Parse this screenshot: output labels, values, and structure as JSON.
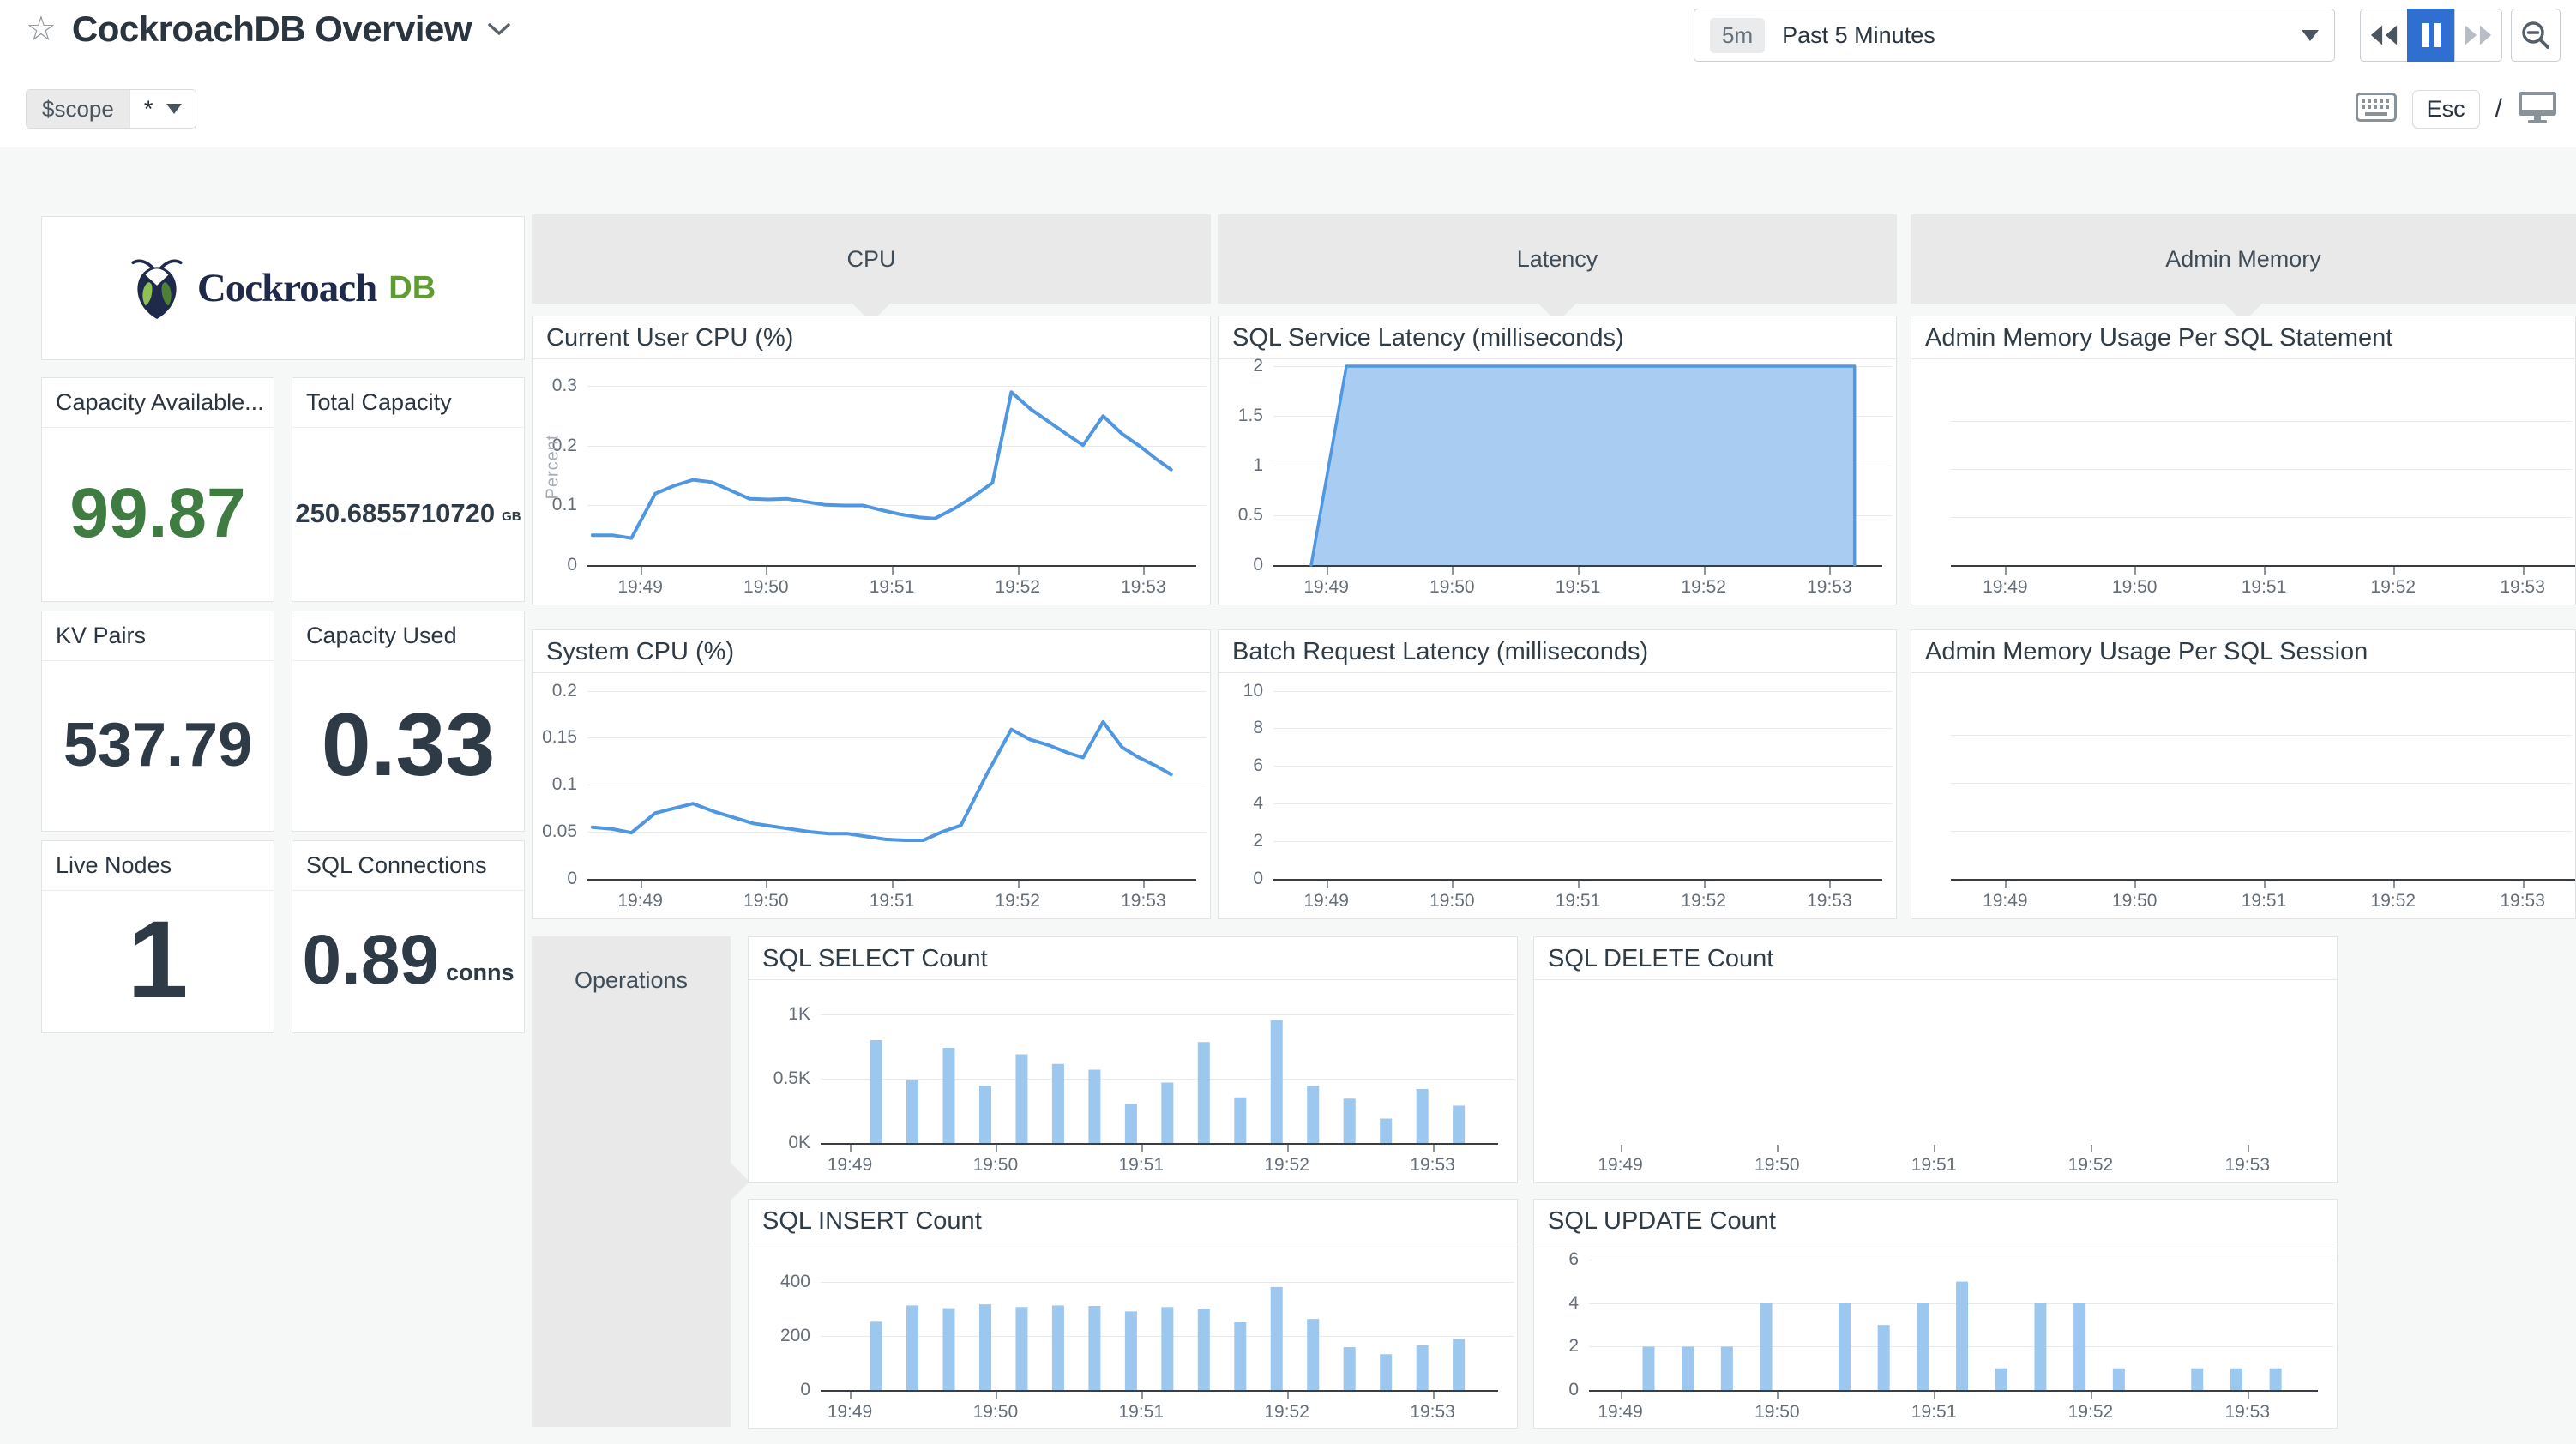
{
  "header": {
    "title": "CockroachDB Overview",
    "time_range": {
      "badge": "5m",
      "label": "Past 5 Minutes"
    },
    "controls": {
      "esc_label": "Esc",
      "slash": "/"
    },
    "scope": {
      "label": "$scope",
      "value": "*"
    }
  },
  "branding": {
    "wordmark": "Cockroach",
    "wordmark_suffix": "DB"
  },
  "sections": {
    "cpu": "CPU",
    "latency": "Latency",
    "admin_memory": "Admin Memory",
    "operations": "Operations"
  },
  "colors": {
    "accent_blue": "#4f97e0",
    "area_fill": "#a9cdf2",
    "bar_blue": "#9cc7ef",
    "stat_green": "#3e7c41",
    "stat_dark": "#2e3a46",
    "active_button_blue": "#2e6fd0",
    "logo_navy": "#1f2a4a",
    "logo_green": "#5f9c31"
  },
  "stats": [
    {
      "id": "capacity-available",
      "title": "Capacity Available...",
      "value": "99.87",
      "unit": ""
    },
    {
      "id": "total-capacity",
      "title": "Total Capacity",
      "value": "250.6855710720",
      "unit": "GB"
    },
    {
      "id": "kv-pairs",
      "title": "KV Pairs",
      "value": "537.79",
      "unit": ""
    },
    {
      "id": "capacity-used",
      "title": "Capacity Used",
      "value": "0.33",
      "unit": ""
    },
    {
      "id": "live-nodes",
      "title": "Live Nodes",
      "value": "1",
      "unit": ""
    },
    {
      "id": "sql-connections",
      "title": "SQL Connections",
      "value": "0.89",
      "unit": "conns"
    }
  ],
  "time_axis": {
    "range": [
      48.58,
      53.42
    ],
    "ticks": [
      {
        "t": 49,
        "l": "19:49"
      },
      {
        "t": 50,
        "l": "19:50"
      },
      {
        "t": 51,
        "l": "19:51"
      },
      {
        "t": 52,
        "l": "19:52"
      },
      {
        "t": 53,
        "l": "19:53"
      }
    ]
  },
  "chart_data": [
    {
      "id": "user-cpu",
      "type": "line",
      "title": "Current User CPU (%)",
      "ylabel": "Percent",
      "ymax": 0.325,
      "yticks": [
        {
          "v": 0,
          "l": "0"
        },
        {
          "v": 0.1,
          "l": "0.1"
        },
        {
          "v": 0.2,
          "l": "0.2"
        },
        {
          "v": 0.3,
          "l": "0.3"
        }
      ],
      "points": [
        [
          48.62,
          0.05
        ],
        [
          48.78,
          0.05
        ],
        [
          48.93,
          0.045
        ],
        [
          49.12,
          0.12
        ],
        [
          49.27,
          0.133
        ],
        [
          49.42,
          0.143
        ],
        [
          49.57,
          0.139
        ],
        [
          49.72,
          0.125
        ],
        [
          49.87,
          0.111
        ],
        [
          50.02,
          0.11
        ],
        [
          50.17,
          0.111
        ],
        [
          50.32,
          0.106
        ],
        [
          50.47,
          0.101
        ],
        [
          50.62,
          0.1
        ],
        [
          50.77,
          0.1
        ],
        [
          50.92,
          0.092
        ],
        [
          51.07,
          0.085
        ],
        [
          51.22,
          0.08
        ],
        [
          51.34,
          0.078
        ],
        [
          51.5,
          0.095
        ],
        [
          51.65,
          0.115
        ],
        [
          51.8,
          0.138
        ],
        [
          51.95,
          0.29
        ],
        [
          52.1,
          0.262
        ],
        [
          52.25,
          0.24
        ],
        [
          52.4,
          0.218
        ],
        [
          52.52,
          0.201
        ],
        [
          52.68,
          0.25
        ],
        [
          52.83,
          0.22
        ],
        [
          52.98,
          0.198
        ],
        [
          53.1,
          0.178
        ],
        [
          53.22,
          0.16
        ]
      ]
    },
    {
      "id": "system-cpu",
      "type": "line",
      "title": "System CPU (%)",
      "ymax": 0.206,
      "yticks": [
        {
          "v": 0,
          "l": "0"
        },
        {
          "v": 0.05,
          "l": "0.05"
        },
        {
          "v": 0.1,
          "l": "0.1"
        },
        {
          "v": 0.15,
          "l": "0.15"
        },
        {
          "v": 0.2,
          "l": "0.2"
        }
      ],
      "points": [
        [
          48.62,
          0.055
        ],
        [
          48.78,
          0.053
        ],
        [
          48.93,
          0.049
        ],
        [
          49.12,
          0.07
        ],
        [
          49.3,
          0.076
        ],
        [
          49.42,
          0.08
        ],
        [
          49.6,
          0.071
        ],
        [
          49.75,
          0.065
        ],
        [
          49.9,
          0.059
        ],
        [
          50.05,
          0.056
        ],
        [
          50.2,
          0.053
        ],
        [
          50.35,
          0.05
        ],
        [
          50.5,
          0.048
        ],
        [
          50.65,
          0.048
        ],
        [
          50.8,
          0.045
        ],
        [
          50.95,
          0.042
        ],
        [
          51.1,
          0.041
        ],
        [
          51.25,
          0.041
        ],
        [
          51.4,
          0.05
        ],
        [
          51.55,
          0.057
        ],
        [
          51.75,
          0.11
        ],
        [
          51.95,
          0.159
        ],
        [
          52.1,
          0.148
        ],
        [
          52.25,
          0.142
        ],
        [
          52.4,
          0.134
        ],
        [
          52.52,
          0.129
        ],
        [
          52.68,
          0.167
        ],
        [
          52.83,
          0.14
        ],
        [
          52.95,
          0.13
        ],
        [
          53.1,
          0.12
        ],
        [
          53.22,
          0.111
        ]
      ]
    },
    {
      "id": "sql-service-latency",
      "type": "area",
      "title": "SQL Service Latency (milliseconds)",
      "ymax": 2,
      "yticks": [
        {
          "v": 0,
          "l": "0"
        },
        {
          "v": 0.5,
          "l": "0.5"
        },
        {
          "v": 1,
          "l": "1"
        },
        {
          "v": 1.5,
          "l": "1.5"
        },
        {
          "v": 2,
          "l": "2"
        }
      ],
      "points": [
        [
          48.88,
          0
        ],
        [
          49.16,
          2
        ],
        [
          53.2,
          2
        ],
        [
          53.2,
          0
        ]
      ]
    },
    {
      "id": "batch-request-latency",
      "type": "empty",
      "title": "Batch Request Latency (milliseconds)",
      "ymax": 10.3,
      "yticks": [
        {
          "v": 0,
          "l": "0"
        },
        {
          "v": 2,
          "l": "2"
        },
        {
          "v": 4,
          "l": "4"
        },
        {
          "v": 6,
          "l": "6"
        },
        {
          "v": 8,
          "l": "8"
        },
        {
          "v": 10,
          "l": "10"
        }
      ]
    },
    {
      "id": "admin-mem-statement",
      "type": "empty",
      "title": "Admin Memory Usage Per SQL Statement",
      "ymax": 1,
      "gridcount": 3
    },
    {
      "id": "admin-mem-session",
      "type": "empty",
      "title": "Admin Memory Usage Per SQL Session",
      "ymax": 1,
      "gridcount": 3
    },
    {
      "id": "sql-select",
      "type": "bar",
      "title": "SQL SELECT Count",
      "ymax": 1160,
      "xrange": [
        48.8,
        53.45
      ],
      "bar_start": 49.18,
      "bar_step": 0.25,
      "yticks": [
        {
          "v": 0,
          "l": "0K"
        },
        {
          "v": 500,
          "l": "0.5K"
        },
        {
          "v": 1000,
          "l": "1K"
        }
      ],
      "values": [
        800,
        490,
        740,
        445,
        690,
        615,
        570,
        305,
        470,
        785,
        355,
        955,
        445,
        345,
        190,
        420,
        290
      ]
    },
    {
      "id": "sql-delete",
      "type": "empty",
      "title": "SQL DELETE Count",
      "ymax": 1,
      "baseline": false,
      "xrange": [
        48.8,
        53.45
      ]
    },
    {
      "id": "sql-insert",
      "type": "bar",
      "title": "SQL INSERT Count",
      "ymax": 500,
      "xrange": [
        48.8,
        53.45
      ],
      "bar_start": 49.18,
      "bar_step": 0.25,
      "yticks": [
        {
          "v": 0,
          "l": "0"
        },
        {
          "v": 200,
          "l": "200"
        },
        {
          "v": 400,
          "l": "400"
        }
      ],
      "values": [
        252,
        312,
        302,
        316,
        306,
        312,
        310,
        290,
        306,
        300,
        250,
        380,
        262,
        158,
        132,
        165,
        188
      ]
    },
    {
      "id": "sql-update",
      "type": "bar",
      "title": "SQL UPDATE Count",
      "ymax": 6.25,
      "xrange": [
        48.8,
        53.45
      ],
      "bar_start": 49.18,
      "bar_step": 0.25,
      "yticks": [
        {
          "v": 0,
          "l": "0"
        },
        {
          "v": 2,
          "l": "2"
        },
        {
          "v": 4,
          "l": "4"
        },
        {
          "v": 6,
          "l": "6"
        }
      ],
      "values": [
        2,
        2,
        2,
        4,
        0,
        4,
        3,
        4,
        5,
        1,
        4,
        4,
        1,
        0,
        1,
        1,
        1
      ]
    }
  ]
}
